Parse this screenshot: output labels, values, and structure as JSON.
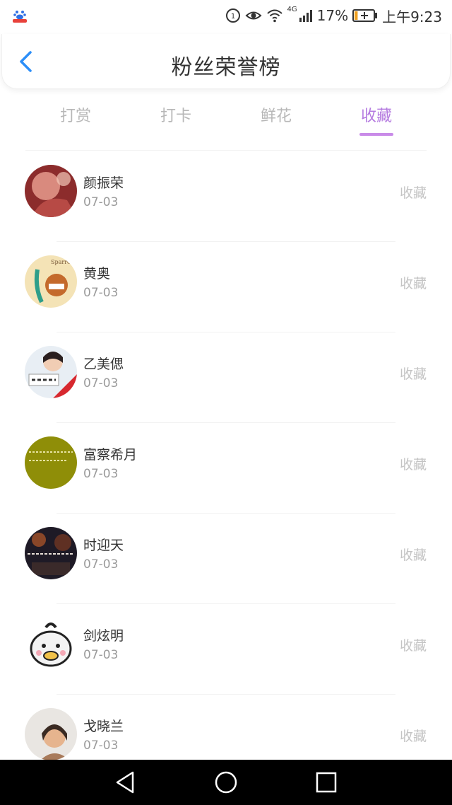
{
  "status_bar": {
    "battery_percent": "17%",
    "time": "上午9:23",
    "network": "4G",
    "battery_level": 0.17
  },
  "header": {
    "title": "粉丝荣誉榜"
  },
  "tabs": [
    {
      "label": "打赏",
      "active": false
    },
    {
      "label": "打卡",
      "active": false
    },
    {
      "label": "鲜花",
      "active": false
    },
    {
      "label": "收藏",
      "active": true
    }
  ],
  "colors": {
    "accent": "#b57be0",
    "inactive_tab": "#b7b7b7",
    "back_arrow": "#2c8ef8"
  },
  "list": [
    {
      "name": "颜振荣",
      "date": "07-03",
      "action": "收藏"
    },
    {
      "name": "黄奥",
      "date": "07-03",
      "action": "收藏"
    },
    {
      "name": "乙美偲",
      "date": "07-03",
      "action": "收藏"
    },
    {
      "name": "富察希月",
      "date": "07-03",
      "action": "收藏"
    },
    {
      "name": "时迎天",
      "date": "07-03",
      "action": "收藏"
    },
    {
      "name": "剑炫明",
      "date": "07-03",
      "action": "收藏"
    },
    {
      "name": "戈晓兰",
      "date": "07-03",
      "action": "收藏"
    }
  ]
}
